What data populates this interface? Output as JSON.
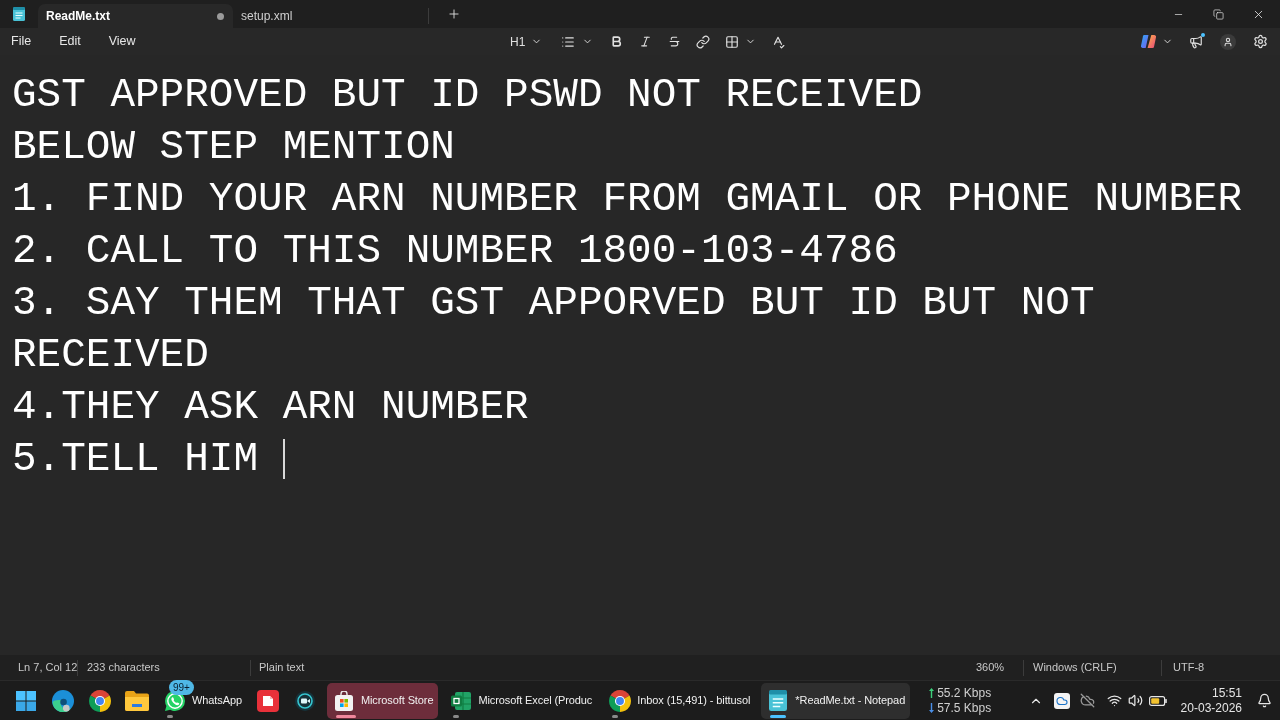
{
  "tabs": [
    {
      "label": "ReadMe.txt",
      "selected": true,
      "unsaved": true
    },
    {
      "label": "setup.xml",
      "selected": false,
      "unsaved": false
    }
  ],
  "menu": [
    {
      "label": "File"
    },
    {
      "label": "Edit"
    },
    {
      "label": "View"
    }
  ],
  "toolbar": {
    "heading": "H1"
  },
  "editor": {
    "lines": [
      "GST APPROVED BUT ID PSWD NOT RECEIVED",
      "BELOW STEP MENTION",
      "1. FIND YOUR ARN NUMBER FROM GMAIL OR PHONE NUMBER",
      "2. CALL TO THIS NUMBER 1800-103-4786",
      "3. SAY THEM THAT GST APPORVED BUT ID BUT NOT RECEIVED",
      "4.THEY ASK ARN NUMBER",
      "5.TELL HIM"
    ]
  },
  "status_bar": {
    "position": "Ln 7, Col 12",
    "characters": "233 characters",
    "format": "Plain text",
    "zoom": "360%",
    "line_ending": "Windows (CRLF)",
    "encoding": "UTF-8"
  },
  "taskbar": {
    "apps": [
      {
        "kind": "start",
        "selected": false,
        "running": false,
        "flashing": false
      },
      {
        "kind": "edge",
        "selected": false,
        "running": false,
        "flashing": false
      },
      {
        "kind": "chrome",
        "selected": false,
        "running": false,
        "flashing": false
      },
      {
        "kind": "folder",
        "selected": false,
        "running": false,
        "flashing": false
      },
      {
        "kind": "whatsapp",
        "label": "WhatsApp",
        "badge": "99+",
        "selected": false,
        "running": true,
        "flashing": false
      },
      {
        "kind": "wps",
        "selected": false,
        "running": false,
        "flashing": false
      },
      {
        "kind": "recorder",
        "selected": false,
        "running": false,
        "flashing": false
      },
      {
        "kind": "store",
        "label": "Microsoft Store",
        "selected": false,
        "running": true,
        "flashing": true
      },
      {
        "kind": "excel",
        "label": "Microsoft Excel (Produc",
        "selected": false,
        "running": true,
        "flashing": false
      },
      {
        "kind": "chrome",
        "label": "Inbox (15,491) - bittusol",
        "selected": false,
        "running": true,
        "flashing": false
      },
      {
        "kind": "notepad",
        "label": "*ReadMe.txt - Notepad",
        "selected": true,
        "running": true,
        "flashing": false
      }
    ],
    "network_speed": {
      "upload": "55.2 Kbps",
      "download": "57.5 Kbps"
    },
    "clock": {
      "time": "15:51",
      "date": "20-03-2026"
    }
  }
}
